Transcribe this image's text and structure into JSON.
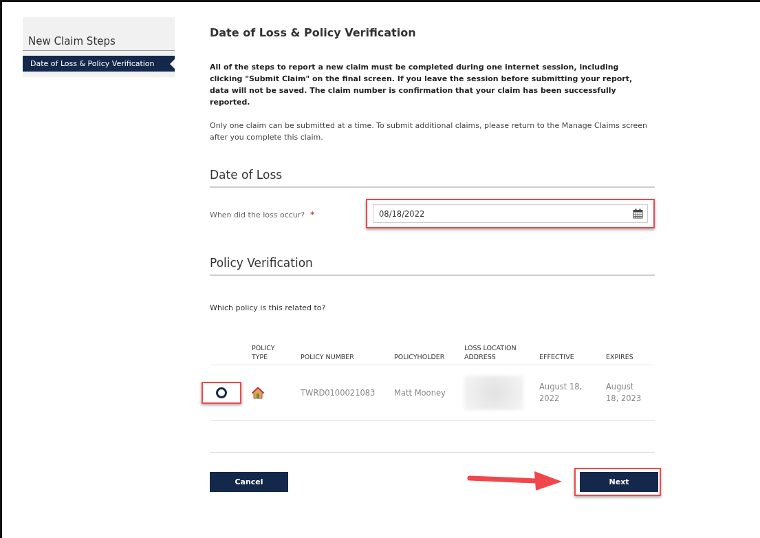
{
  "sidebar": {
    "title": "New Claim Steps",
    "items": [
      {
        "label": "Date of Loss & Policy Verification",
        "selected": true
      }
    ]
  },
  "page_title": "Date of Loss & Policy Verification",
  "notice": "All of the steps to report a new claim must be completed during one internet session, including clicking \"Submit Claim\" on the final screen. If you leave the session before submitting your report, data will not be saved. The claim number is confirmation that your claim has been successfully reported.",
  "info": "Only one claim can be submitted at a time. To submit additional claims, please return to the Manage Claims screen after you complete this claim.",
  "date_of_loss": {
    "heading": "Date of Loss",
    "label": "When did the loss occur?",
    "required_mark": "*",
    "value": "08/18/2022",
    "highlighted": true
  },
  "policy_verification": {
    "heading": "Policy Verification",
    "question": "Which policy is this related to?",
    "columns": [
      "POLICY TYPE",
      "POLICY NUMBER",
      "POLICYHOLDER",
      "LOSS LOCATION ADDRESS",
      "EFFECTIVE",
      "EXPIRES"
    ],
    "rows": [
      {
        "selected": false,
        "highlighted": true,
        "policy_number": "TWRD0100021083",
        "policyholder": "Matt Mooney",
        "effective": "August 18, 2022",
        "expires": "August 18, 2023"
      }
    ]
  },
  "buttons": [
    {
      "label": "Cancel",
      "highlighted": false,
      "arrow": false
    },
    {
      "label": "Next",
      "highlighted": true,
      "arrow": true
    }
  ]
}
